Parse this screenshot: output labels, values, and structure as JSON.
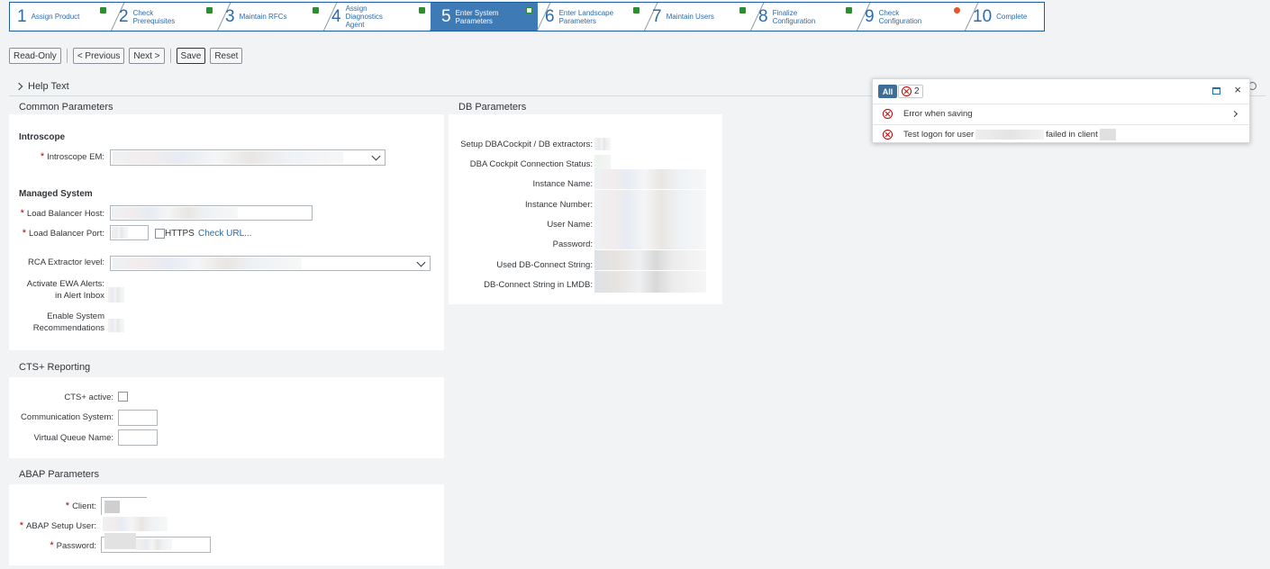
{
  "roadmap": {
    "steps": [
      {
        "num": "1",
        "label": "Assign Product",
        "status": "done"
      },
      {
        "num": "2",
        "label": "Check Prerequisites",
        "status": "done"
      },
      {
        "num": "3",
        "label": "Maintain RFCs",
        "status": "done"
      },
      {
        "num": "4",
        "label": "Assign Diagnostics Agent",
        "status": "done"
      },
      {
        "num": "5",
        "label": "Enter System Parameters",
        "status": "done",
        "active": true
      },
      {
        "num": "6",
        "label": "Enter Landscape Parameters",
        "status": "done"
      },
      {
        "num": "7",
        "label": "Maintain Users",
        "status": "done"
      },
      {
        "num": "8",
        "label": "Finalize Configuration",
        "status": "done"
      },
      {
        "num": "9",
        "label": "Check Configuration",
        "status": "error"
      },
      {
        "num": "10",
        "label": "Complete",
        "status": "none"
      }
    ]
  },
  "toolbar": {
    "read_only": "Read-Only",
    "previous": "< Previous",
    "next": "Next >",
    "save": "Save",
    "reset": "Reset"
  },
  "help": {
    "label": "Help Text"
  },
  "common": {
    "title": "Common Parameters",
    "introscope_title": "Introscope",
    "introscope_em": "Introscope EM:",
    "managed_title": "Managed System",
    "lb_host": "Load Balancer Host:",
    "lb_port": "Load Balancer Port:",
    "https": "HTTPS",
    "check_url": "Check URL...",
    "rca": "RCA Extractor level:",
    "ewa_1": "Activate EWA Alerts:",
    "ewa_2": "in Alert Inbox",
    "sysrec_1": "Enable System",
    "sysrec_2": "Recommendations"
  },
  "db": {
    "title": "DB Parameters",
    "setup": "Setup DBACockpit / DB extractors:",
    "conn_status": "DBA Cockpit Connection Status:",
    "instance_name": "Instance Name:",
    "instance_number": "Instance Number:",
    "user_name": "User Name:",
    "password": "Password:",
    "used_conn": "Used DB-Connect String:",
    "lmdb_conn": "DB-Connect String in LMDB:"
  },
  "cts": {
    "title": "CTS+ Reporting",
    "active": "CTS+ active:",
    "comm_system": "Communication System:",
    "queue": "Virtual Queue Name:"
  },
  "abap": {
    "title": "ABAP Parameters",
    "client": "Client:",
    "setup_user": "ABAP Setup User:",
    "password": "Password:"
  },
  "messages": {
    "all_label": "All",
    "error_count": "2",
    "items": [
      {
        "text": "Error when saving"
      },
      {
        "text_a": "Test logon for user",
        "text_b": "failed in client"
      }
    ]
  },
  "colors": {
    "accent": "#3e7bb6",
    "error": "#bb0000",
    "success": "#2b8f2b"
  }
}
